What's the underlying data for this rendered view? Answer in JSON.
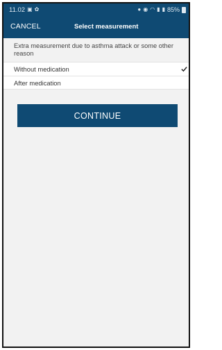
{
  "status_bar": {
    "time": "11.02",
    "battery": "85%"
  },
  "app_bar": {
    "cancel_label": "CANCEL",
    "title": "Select measurement"
  },
  "info_text": "Extra measurement due to asthma attack or some other reason",
  "options": [
    {
      "label": "Without medication",
      "selected": true
    },
    {
      "label": "After medication",
      "selected": false
    }
  ],
  "continue_label": "CONTINUE",
  "colors": {
    "primary": "#0f4a73",
    "background": "#f2f2f2",
    "option_bg": "#ffffff"
  }
}
